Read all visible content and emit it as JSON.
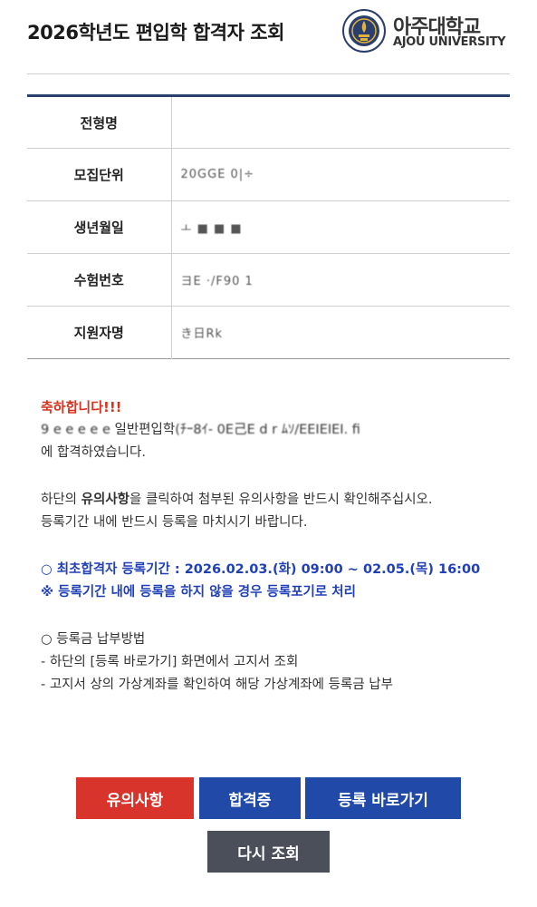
{
  "header": {
    "title": "2026학년도 편입학 합격자 조회",
    "logo_ko": "아주대학교",
    "logo_en": "AJOU UNIVERSITY",
    "brand_color": "#2a3f6d"
  },
  "info": {
    "rows": [
      {
        "label": "전형명",
        "value": ""
      },
      {
        "label": "모집단위",
        "value": "20GGE 0|÷"
      },
      {
        "label": "생년월일",
        "value": "ㅗ   ■   ■   ■"
      },
      {
        "label": "수험번호",
        "value": "ヨE ·/F90 1"
      },
      {
        "label": "지원자명",
        "value": "き日Rk"
      }
    ]
  },
  "message": {
    "congrats": "축하합니다!!!",
    "line1_redacted_prefix": "9 e e e e e",
    "line1_middle": "일반편입학",
    "line1_redacted_suffix": "(ﾁｰ8ｲ-  0E己E d r  ﾑｿ/EEIEIEI.   fi",
    "line2": "에 합격하였습니다.",
    "notice_pre": "하단의 ",
    "notice_bold": "유의사항",
    "notice_post": "을 클릭하여 첨부된 유의사항을 반드시 확인해주십시오.",
    "notice_line2": "등록기간 내에 반드시 등록을 마치시기 바랍니다.",
    "period": "○ 최초합격자 등록기간 : 2026.02.03.(화) 09:00 ~ 02.05.(목) 16:00",
    "period_warning": "※ 등록기간 내에 등록을 하지 않을 경우 등록포기로 처리",
    "payment_title": "○ 등록금 납부방법",
    "payment_step1": "- 하단의 [등록 바로가기] 화면에서 고지서 조회",
    "payment_step2": "- 고지서 상의 가상계좌를 확인하여 해당 가상계좌에 등록금 납부",
    "accent_red": "#d8321e",
    "accent_blue": "#2040b8"
  },
  "buttons": {
    "notice": "유의사항",
    "certificate": "합격증",
    "register": "등록 바로가기",
    "search_again": "다시 조회"
  }
}
